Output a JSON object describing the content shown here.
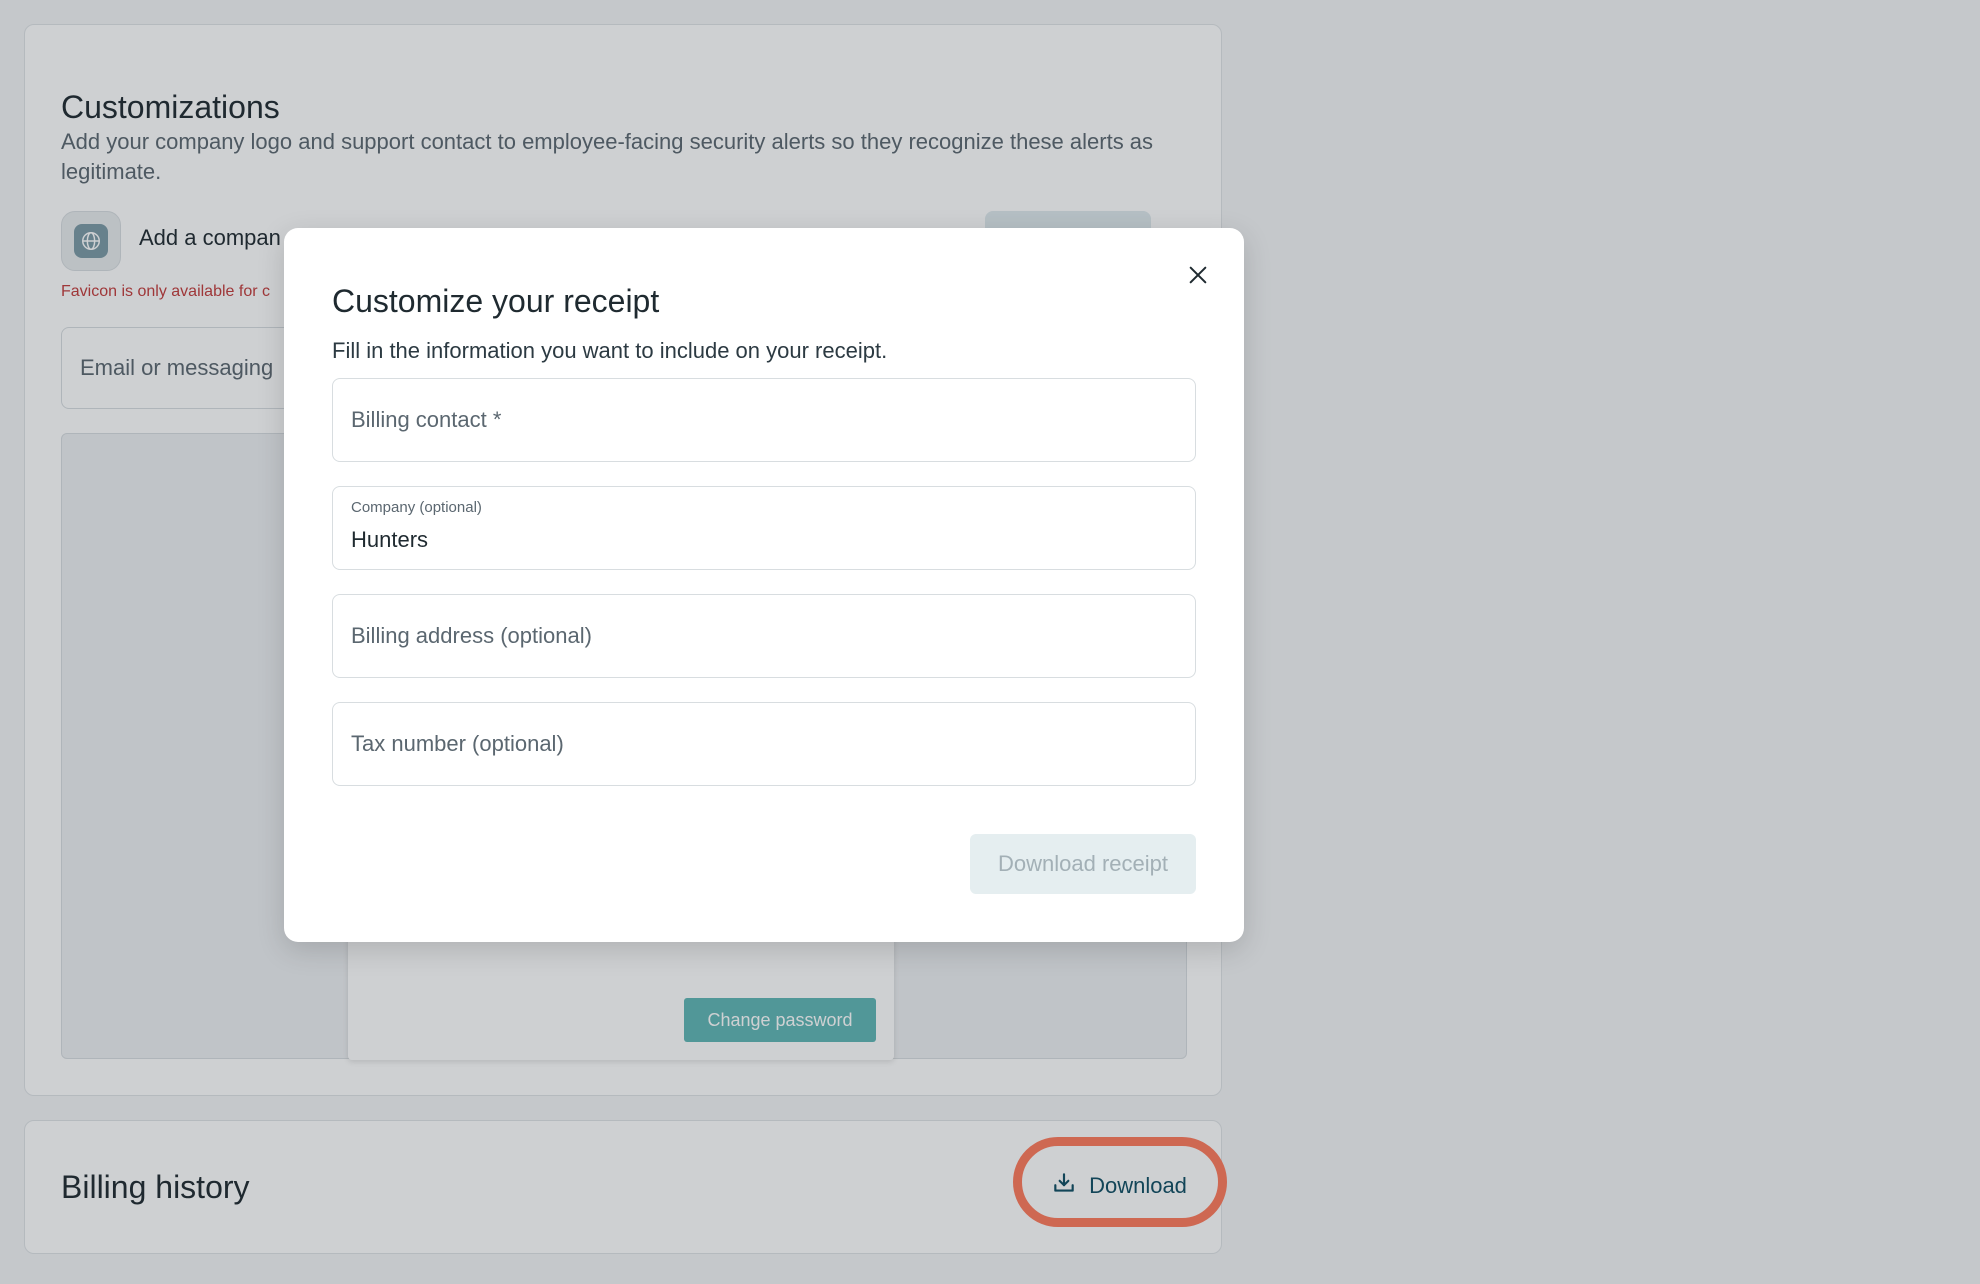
{
  "customizations": {
    "title": "Customizations",
    "description": "Add your company logo and support contact to employee-facing security alerts so they recognize these alerts as legitimate.",
    "logo_label": "Add a compan",
    "favicon_note": "Favicon is only available for c",
    "email_placeholder": "Email or messaging",
    "preview": {
      "change_password_label": "Change password"
    }
  },
  "billing_history": {
    "title": "Billing history",
    "download_label": "Download"
  },
  "modal": {
    "title": "Customize your receipt",
    "description": "Fill in the information you want to include on your receipt.",
    "fields": {
      "billing_contact": {
        "placeholder": "Billing contact *"
      },
      "company": {
        "label": "Company (optional)",
        "value": "Hunters"
      },
      "billing_address": {
        "placeholder": "Billing address (optional)"
      },
      "tax_number": {
        "placeholder": "Tax number (optional)"
      }
    },
    "submit_label": "Download receipt"
  },
  "icons": {
    "close": "close-icon",
    "download": "download-icon",
    "globe": "globe-icon"
  },
  "colors": {
    "accent": "#0f4d63",
    "highlight": "#ff7a5c",
    "error": "#c33b3b",
    "preview_button": "#5fb7b5"
  }
}
